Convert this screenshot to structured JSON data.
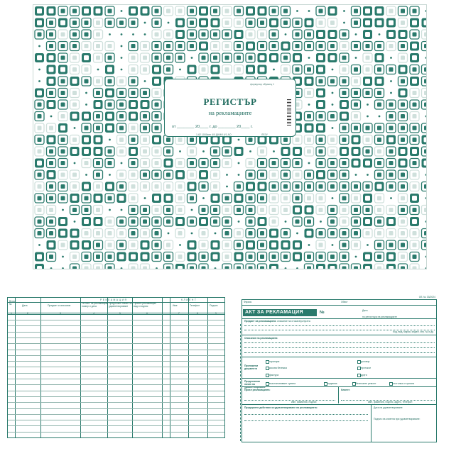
{
  "cover": {
    "publisher_note": "формуляр образец 1",
    "title": "РЕГИСТЪР",
    "subtitle": "на рекламациите",
    "dates_line": "от ________ 20____ г. до ________ 20____ г.",
    "footer_code": "1-62 1000хех 4/0  ДКМИ 4/1 АО",
    "footer_right": "ЛЕЗУ"
  },
  "register_page": {
    "group_header": "РЕКЛАМАЦИЯ",
    "client_header": "КЛИЕНТ",
    "columns": [
      "Вход. №",
      "Дата",
      "Предмет и описание",
      "По бил. за рекламация номер и дата",
      "Предложен начин за удовлетворяване",
      "Приети рекламации вид и подпис",
      "Име",
      "Телефон",
      "Подпис"
    ],
    "col_numbers": [
      "1",
      "2",
      "3",
      "4",
      "5",
      "6",
      "7",
      "8",
      "9"
    ]
  },
  "act": {
    "form_no": "Об. № 33/2024",
    "firm_label": "Фирма:",
    "object_label": "Обект",
    "title": "АКТ ЗА РЕКЛАМАЦИЯ",
    "number_label": "№",
    "date_label": "Дата",
    "registry_note": "по регистъра на рекламациите",
    "subject_label": "Предмет на рекламацията:",
    "subject_hint": "описание на стоката/услугата",
    "quantity_note": "Код, вид, марка, модел, сер. № и др.",
    "description_label": "Описание на рекламацията:",
    "docs_label": "Приложени документи",
    "doc_items": [
      "гаранция",
      "касова бележка",
      "фактура",
      "протокол",
      "договор",
      "други"
    ],
    "remedy_label": "Предпочитан начин на удовлетворяване",
    "remedy_items": [
      "възстановяване сумата",
      "подмяна",
      "безплатен ремонт",
      "отстъпка от цената"
    ],
    "receiver_label": "Приел рекламацията:",
    "client_label": "Клиент:",
    "signature_hint": "име, фамилия, подпис",
    "client_hint": "име, фамилия, подпис, адрес, телефон",
    "actions_label": "Предприети действия за удовлетворяване на рекламацията:",
    "satisfied_date": "Дата на удовлетворяване:",
    "client_sign": "Подпис на клиента при удовлетворяване:"
  },
  "colors": {
    "accent": "#2a7a6c",
    "light": "#cfe0dc"
  }
}
